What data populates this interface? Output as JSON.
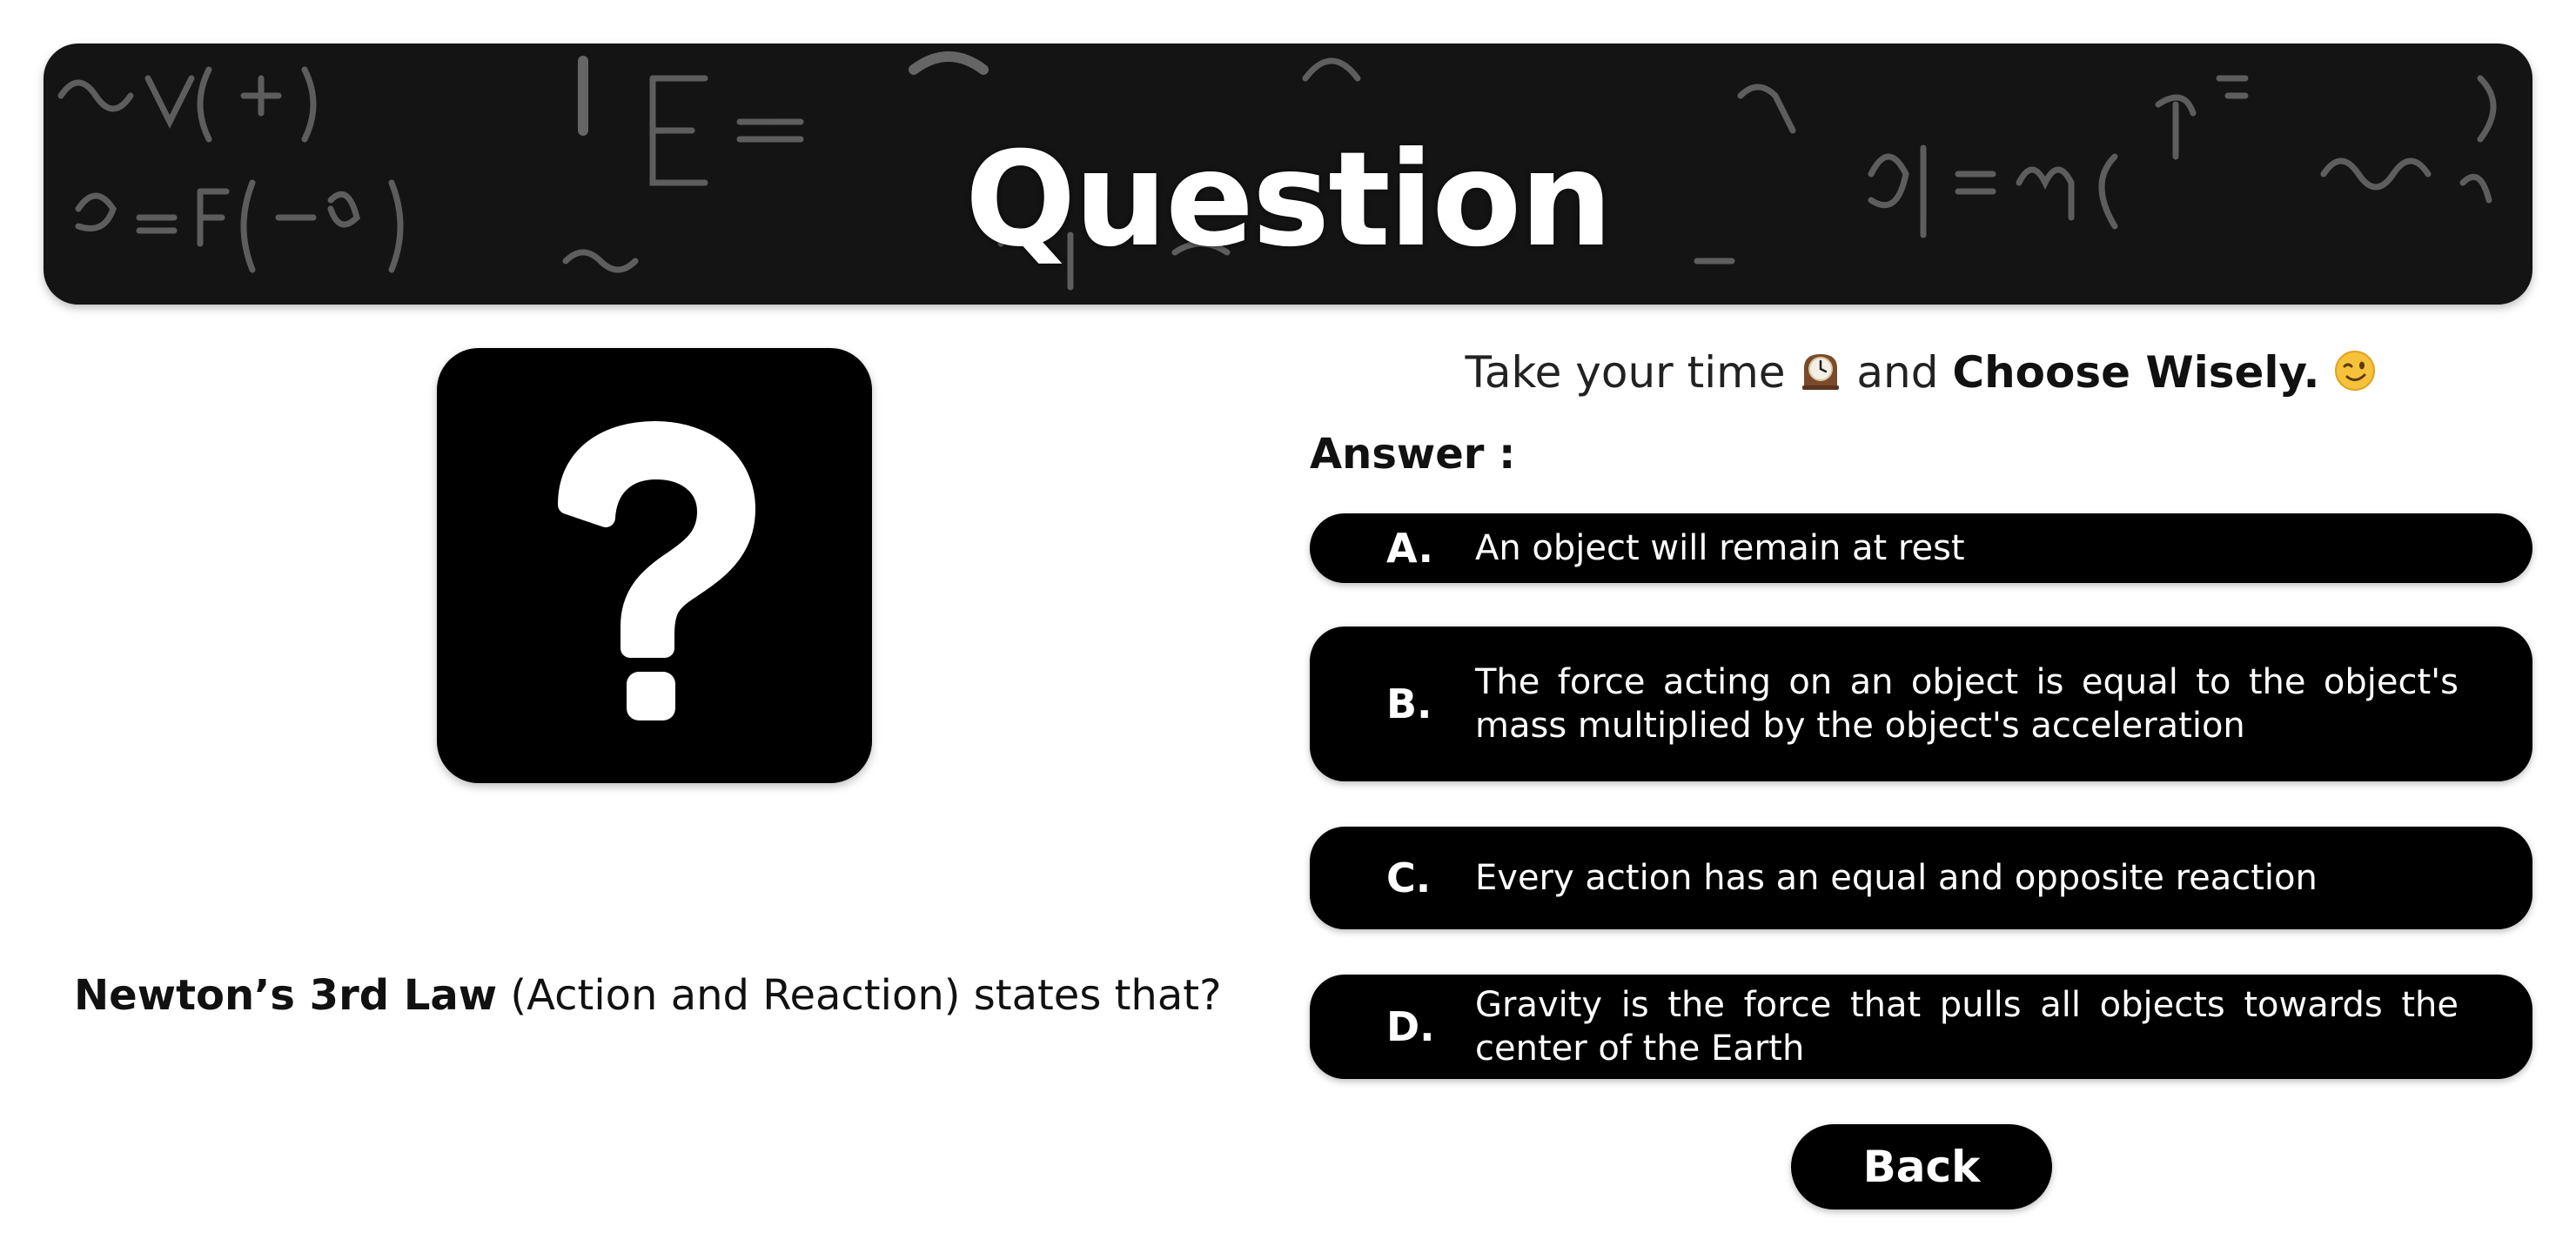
{
  "header": {
    "title": "Question",
    "background_icon": "physics-formulas-chalkboard"
  },
  "question_image": {
    "icon": "question-mark-icon"
  },
  "question": {
    "law": "Newton’s 3rd Law",
    "rest": " (Action and Reaction) states that?"
  },
  "tagline": {
    "prefix": "Take your time",
    "middle": "and",
    "emphasis": "Choose Wisely.",
    "clock_icon": "mantelpiece-clock-icon",
    "wink_icon": "winking-face-icon"
  },
  "answer_label": "Answer :",
  "options": [
    {
      "letter": "A.",
      "text": "An object will remain at rest"
    },
    {
      "letter": "B.",
      "text": "The force acting on an object is equal to the object's mass multiplied by the object's acceleration"
    },
    {
      "letter": "C.",
      "text": "Every action has an equal and opposite reaction"
    },
    {
      "letter": "D.",
      "text": "Gravity is the force that pulls all objects towards the center of the Earth"
    }
  ],
  "back_button": {
    "label": "Back"
  },
  "colors": {
    "background": "#ffffff",
    "button": "#000000",
    "button_text": "#ffffff",
    "header_bg": "#141414"
  }
}
